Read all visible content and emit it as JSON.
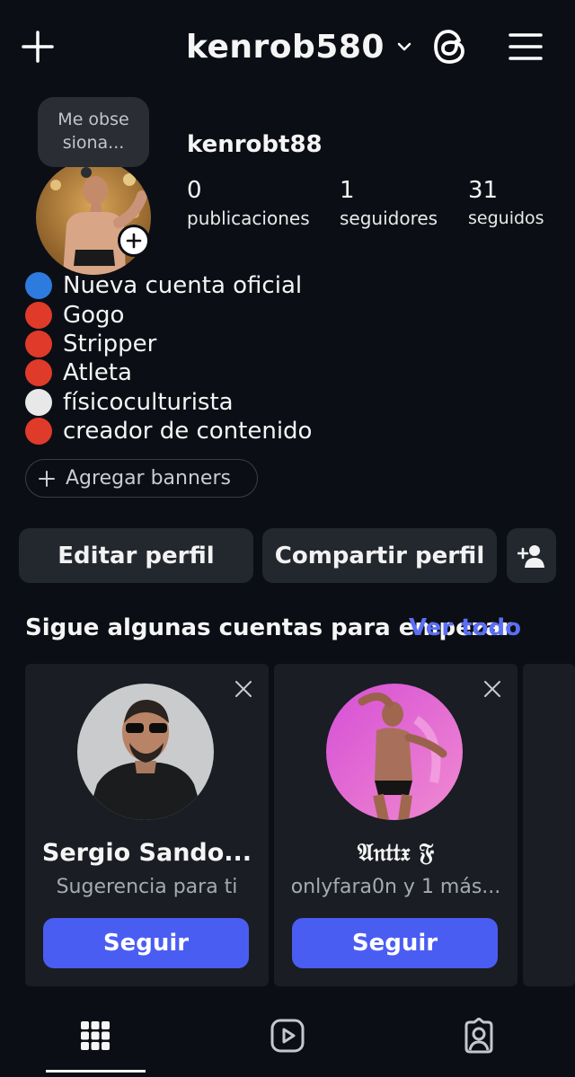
{
  "header": {
    "add_icon": "plus-icon",
    "username": "kenrob580",
    "threads_icon": "threads-icon",
    "menu_icon": "hamburger-menu-icon"
  },
  "note": {
    "text": "Me obse siona..."
  },
  "profile": {
    "display_username": "kenrobt88",
    "stats": [
      {
        "value": "0",
        "label": "publicaciones"
      },
      {
        "value": "1",
        "label": "seguidores"
      },
      {
        "value": "31",
        "label": "seguidos"
      }
    ]
  },
  "bio": [
    {
      "dot_color": "#2e7be0",
      "text": "Nueva cuenta oficial"
    },
    {
      "dot_color": "#e03a2b",
      "text": "Gogo"
    },
    {
      "dot_color": "#e03a2b",
      "text": "Stripper"
    },
    {
      "dot_color": "#e03a2b",
      "text": "Atleta"
    },
    {
      "dot_color": "#e8e8e8",
      "text": "físicoculturista"
    },
    {
      "dot_color": "#e03a2b",
      "text": "creador de contenido"
    }
  ],
  "banner_button": "Agregar banners",
  "actions": {
    "edit": "Editar perfil",
    "share": "Compartir perfil",
    "discover_icon": "add-person-icon"
  },
  "suggestions": {
    "title": "Sigue algunas cuentas para empezar",
    "see_all": "Ver todo",
    "cards": [
      {
        "name": "Sergio Sando...",
        "subtitle": "Sugerencia para ti",
        "button": "Seguir"
      },
      {
        "name": "𝔄𝔫𝔱𝔱𝔵 𝔉",
        "subtitle": "onlyfara0n y 1 más...",
        "button": "Seguir"
      }
    ]
  },
  "tabs": [
    "grid-icon",
    "reels-icon",
    "tagged-icon"
  ],
  "colors": {
    "accent": "#4a5df2",
    "link": "#5b6ef5",
    "background": "#0b0f15"
  }
}
